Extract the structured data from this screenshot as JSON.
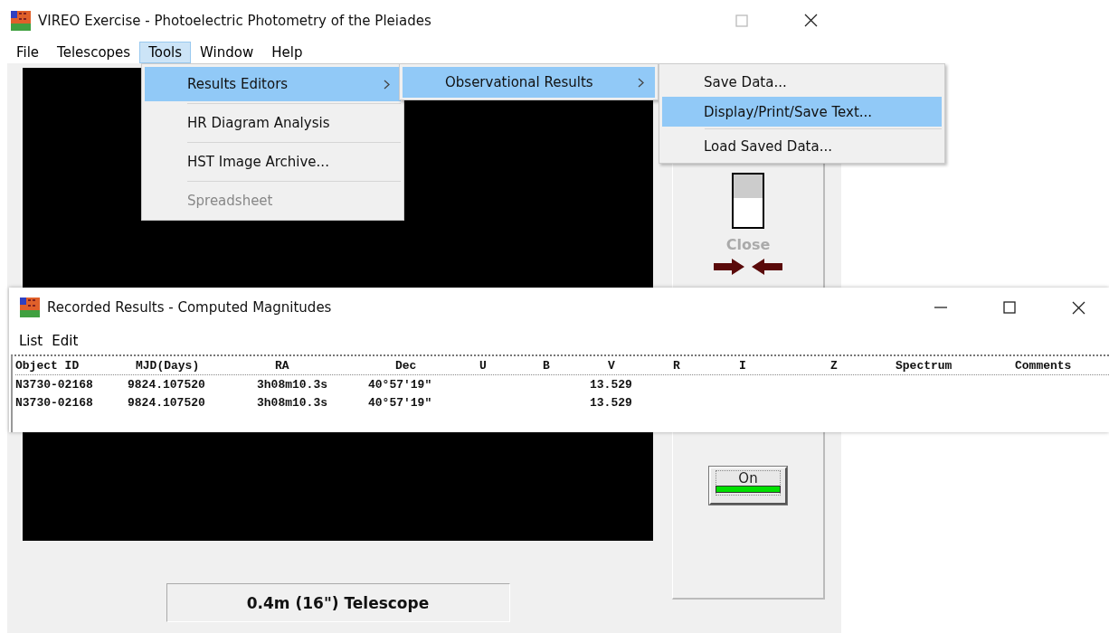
{
  "main_window": {
    "title": "VIREO Exercise - Photoelectric Photometry of the Pleiades",
    "menu": [
      {
        "label": "File",
        "selected": false
      },
      {
        "label": "Telescopes",
        "selected": false
      },
      {
        "label": "Tools",
        "selected": true
      },
      {
        "label": "Window",
        "selected": false
      },
      {
        "label": "Help",
        "selected": false
      }
    ],
    "tools_menu": [
      {
        "label": "Results Editors",
        "selected": true,
        "disabled": false,
        "submenu": true,
        "separator_after": true
      },
      {
        "label": "HR Diagram Analysis",
        "selected": false,
        "disabled": false,
        "submenu": false,
        "separator_after": true
      },
      {
        "label": "HST Image Archive...",
        "selected": false,
        "disabled": false,
        "submenu": false,
        "separator_after": true
      },
      {
        "label": "Spreadsheet",
        "selected": false,
        "disabled": true,
        "submenu": false,
        "separator_after": false
      }
    ],
    "results_editors_menu": [
      {
        "label": "Observational Results",
        "selected": true,
        "disabled": false,
        "submenu": true,
        "separator_after": false
      }
    ],
    "observational_results_menu": [
      {
        "label": "Save Data...",
        "selected": false,
        "disabled": false,
        "submenu": false,
        "separator_after": false
      },
      {
        "label": "Display/Print/Save Text...",
        "selected": true,
        "disabled": false,
        "submenu": false,
        "separator_after": true
      },
      {
        "label": "Load Saved Data...",
        "selected": false,
        "disabled": false,
        "submenu": false,
        "separator_after": false
      }
    ],
    "dome_switch": {
      "label": "Close",
      "disabled": true,
      "on": false
    },
    "power_button": {
      "label": "On",
      "on": true
    },
    "telescope_label": "0.4m (16\") Telescope"
  },
  "results_window": {
    "title": "Recorded Results - Computed Magnitudes",
    "menu": [
      "List",
      "Edit"
    ],
    "table": {
      "columns": [
        "Object ID",
        "MJD(Days)",
        "RA",
        "Dec",
        "U",
        "B",
        "V",
        "R",
        "I",
        "Z",
        "Spectrum",
        "Comments"
      ],
      "rows": [
        {
          "object_id": "N3730-02168",
          "mjd": "9824.107520",
          "ra": "3h08m10.3s",
          "dec": "40°57'19\"",
          "v": "13.529"
        },
        {
          "object_id": "N3730-02168",
          "mjd": "9824.107520",
          "ra": "3h08m10.3s",
          "dec": "40°57'19\"",
          "v": "13.529"
        }
      ]
    }
  }
}
